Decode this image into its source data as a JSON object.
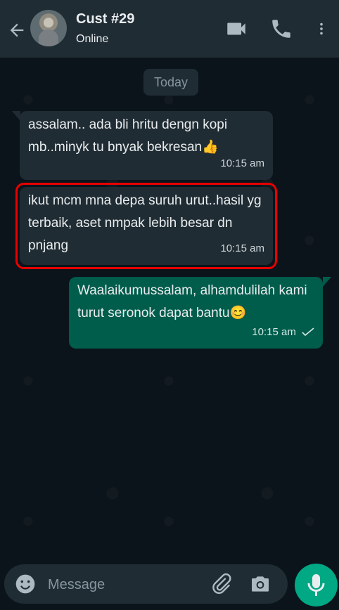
{
  "header": {
    "contact_name": "Cust #29",
    "status": "Online"
  },
  "chat": {
    "date_separator": "Today",
    "messages": [
      {
        "direction": "incoming",
        "text": "assalam.. ada bli hritu dengn kopi mb..minyk tu bnyak bekresan👍",
        "time": "10:15 am",
        "highlighted": false
      },
      {
        "direction": "incoming",
        "text": "ikut mcm mna depa suruh urut..hasil yg terbaik, aset nmpak lebih besar dn pnjang",
        "time": "10:15 am",
        "highlighted": true
      },
      {
        "direction": "outgoing",
        "text": "Waalaikumussalam, alhamdulilah kami turut seronok dapat bantu😊",
        "time": "10:15 am",
        "status": "sent"
      }
    ]
  },
  "input": {
    "placeholder": "Message"
  },
  "colors": {
    "header_bg": "#202c33",
    "incoming_bubble": "#202c33",
    "outgoing_bubble": "#005c4b",
    "accent": "#00a884",
    "highlight": "#e80000"
  },
  "icons": {
    "back": "arrow-left-icon",
    "video": "video-icon",
    "call": "phone-icon",
    "more": "more-vert-icon",
    "emoji": "smile-icon",
    "attach": "paperclip-icon",
    "camera": "camera-icon",
    "mic": "mic-icon"
  }
}
